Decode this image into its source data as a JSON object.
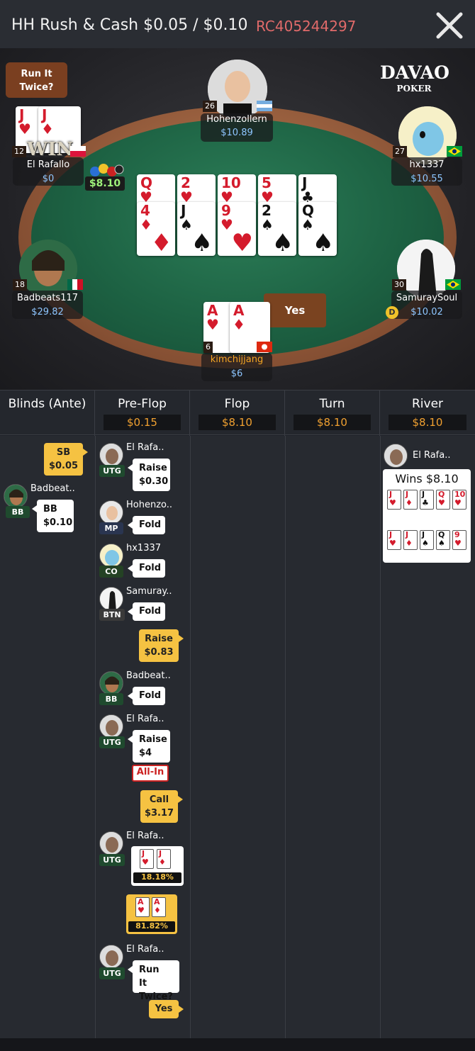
{
  "header": {
    "title": "HH  Rush & Cash $0.05 / $0.10",
    "hand_id": "RC405244297",
    "close_icon": "close-icon"
  },
  "table": {
    "logo_main": "DAVAO",
    "logo_sub": "POKER",
    "run_it_twice_bubble": "Run It Twice?",
    "pot": "$8.10",
    "yes_button": "Yes",
    "win_label": "WIN",
    "dealer_button": "D",
    "players": {
      "top": {
        "name": "Hohenzollern",
        "stack": "$10.89",
        "level": "26"
      },
      "top_left": {
        "name": "El Rafallo",
        "stack": "$0",
        "level": "12"
      },
      "top_right": {
        "name": "hx1337",
        "stack": "$10.55",
        "level": "27"
      },
      "mid_left": {
        "name": "Badbeats117",
        "stack": "$29.82",
        "level": "18"
      },
      "mid_right": {
        "name": "SamuraySoul",
        "stack": "$10.02",
        "level": "30"
      },
      "hero": {
        "name": "kimchijjang",
        "stack": "$6",
        "level": "6"
      }
    },
    "board_run1": [
      {
        "rank": "Q",
        "suit": "♥"
      },
      {
        "rank": "2",
        "suit": "♥"
      },
      {
        "rank": "10",
        "suit": "♥"
      },
      {
        "rank": "5",
        "suit": "♥"
      },
      {
        "rank": "J",
        "suit": "♣"
      }
    ],
    "board_run2": [
      {
        "rank": "4",
        "suit": "♦"
      },
      {
        "rank": "J",
        "suit": "♠"
      },
      {
        "rank": "9",
        "suit": "♥"
      },
      {
        "rank": "2",
        "suit": "♠"
      },
      {
        "rank": "Q",
        "suit": "♠"
      }
    ],
    "villain_cards": [
      {
        "rank": "J",
        "suit": "♥"
      },
      {
        "rank": "J",
        "suit": "♦"
      }
    ],
    "hero_cards": [
      {
        "rank": "A",
        "suit": "♥"
      },
      {
        "rank": "A",
        "suit": "♦"
      }
    ]
  },
  "streets": [
    {
      "label": "Blinds (Ante)",
      "amount": ""
    },
    {
      "label": "Pre-Flop",
      "amount": "$0.15"
    },
    {
      "label": "Flop",
      "amount": "$8.10"
    },
    {
      "label": "Turn",
      "amount": "$8.10"
    },
    {
      "label": "River",
      "amount": "$8.10"
    }
  ],
  "blinds": {
    "sb_label": "SB",
    "sb_amount": "$0.05",
    "bb_player": "Badbeat..",
    "bb_pos": "BB",
    "bb_label": "BB",
    "bb_amount": "$0.10"
  },
  "preflop": {
    "a1": {
      "player": "El Rafa..",
      "pos": "UTG",
      "action": "Raise",
      "amount": "$0.30"
    },
    "a2": {
      "player": "Hohenzo..",
      "pos": "MP",
      "action": "Fold"
    },
    "a3": {
      "player": "hx1337",
      "pos": "CO",
      "action": "Fold"
    },
    "a4": {
      "player": "Samuray..",
      "pos": "BTN",
      "action": "Fold"
    },
    "a5": {
      "action": "Raise",
      "amount": "$0.83"
    },
    "a6": {
      "player": "Badbeat..",
      "pos": "BB",
      "action": "Fold"
    },
    "a7": {
      "player": "El Rafa..",
      "pos": "UTG",
      "action": "Raise",
      "amount": "$4",
      "allin": "All-In"
    },
    "a8": {
      "action": "Call",
      "amount": "$3.17"
    },
    "a9": {
      "player": "El Rafa..",
      "pos": "UTG",
      "equity": "18.18%",
      "cards": [
        {
          "rank": "J",
          "suit": "♥"
        },
        {
          "rank": "J",
          "suit": "♦"
        }
      ]
    },
    "a10": {
      "equity": "81.82%",
      "cards": [
        {
          "rank": "A",
          "suit": "♥"
        },
        {
          "rank": "A",
          "suit": "♦"
        }
      ]
    },
    "a11": {
      "player": "El Rafa..",
      "pos": "UTG",
      "action": "Run It Twice?"
    },
    "a12": {
      "action": "Yes"
    }
  },
  "river": {
    "player": "El Rafa..",
    "result": "Wins $8.10",
    "run1": [
      {
        "rank": "J",
        "suit": "♥"
      },
      {
        "rank": "J",
        "suit": "♦"
      },
      {
        "rank": "J",
        "suit": "♣"
      },
      {
        "rank": "Q",
        "suit": "♥"
      },
      {
        "rank": "10",
        "suit": "♥"
      }
    ],
    "run2": [
      {
        "rank": "J",
        "suit": "♥"
      },
      {
        "rank": "J",
        "suit": "♦"
      },
      {
        "rank": "J",
        "suit": "♠"
      },
      {
        "rank": "Q",
        "suit": "♠"
      },
      {
        "rank": "9",
        "suit": "♥"
      }
    ]
  }
}
